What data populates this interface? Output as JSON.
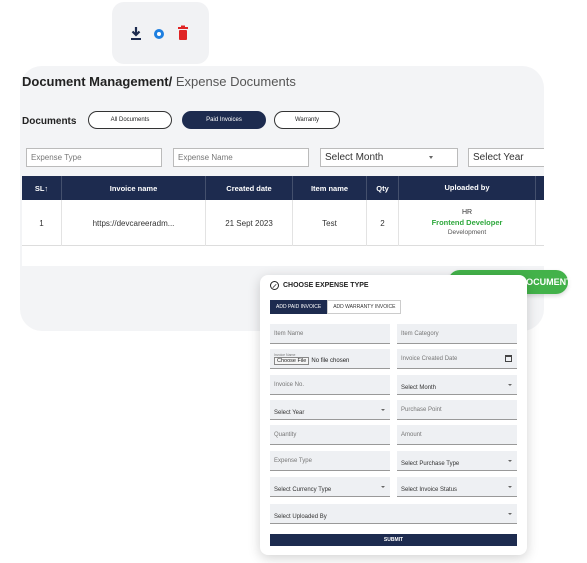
{
  "toolbar": {
    "download_icon": "download-icon",
    "view_icon": "eye-icon",
    "delete_icon": "trash-icon",
    "colors": {
      "download": "#1d2b4f",
      "view": "#1e7fe0",
      "delete": "#e02424"
    }
  },
  "breadcrumb": {
    "bold": "Document Management/",
    "light": " Expense Documents"
  },
  "documents": {
    "label": "Documents",
    "tabs": [
      {
        "label": "All Documents",
        "active": false
      },
      {
        "label": "Paid Invoices",
        "active": true
      },
      {
        "label": "Warranty",
        "active": false
      }
    ]
  },
  "filters": {
    "expense_type_placeholder": "Expense Type",
    "expense_name_placeholder": "Expense Name",
    "month": "Select Month",
    "year": "Select Year"
  },
  "table": {
    "headers": [
      "SL↑",
      "Invoice name",
      "Created date",
      "Item name",
      "Qty",
      "Uploaded by"
    ],
    "rows": [
      {
        "sl": "1",
        "invoice": "https://devcareeradm...",
        "date": "21 Sept 2023",
        "item": "Test",
        "qty": "2",
        "uploaded_dept": "HR",
        "uploaded_role": "Frontend Developer",
        "uploaded_sub": "Development"
      }
    ]
  },
  "add_button": {
    "label": "ADD NEW DOCUMENT",
    "color": "#43b24a"
  },
  "modal": {
    "title": "CHOOSE EXPENSE TYPE",
    "tabs": [
      "ADD PAID INVOICE",
      "ADD WARRANTY INVOICE"
    ],
    "fields": {
      "item_name": "Item Name",
      "item_category": "Item Category",
      "file_label": "Invoice Name",
      "file_button": "Choose File",
      "file_status": "No file chosen",
      "invoice_date": "Invoice Created Date",
      "invoice_no": "Invoice No.",
      "select_month": "Select Month",
      "select_year": "Select Year",
      "purchase_point": "Purchase Point",
      "quantity": "Quantity",
      "amount": "Amount",
      "expense_type": "Expense Type",
      "purchase_type": "Select Purchase Type",
      "currency_type": "Select Currency Type",
      "invoice_status": "Select Invoice Status",
      "uploaded_by": "Select Uploaded By"
    },
    "submit": "SUBMIT"
  },
  "accent": "#1d2b4f"
}
